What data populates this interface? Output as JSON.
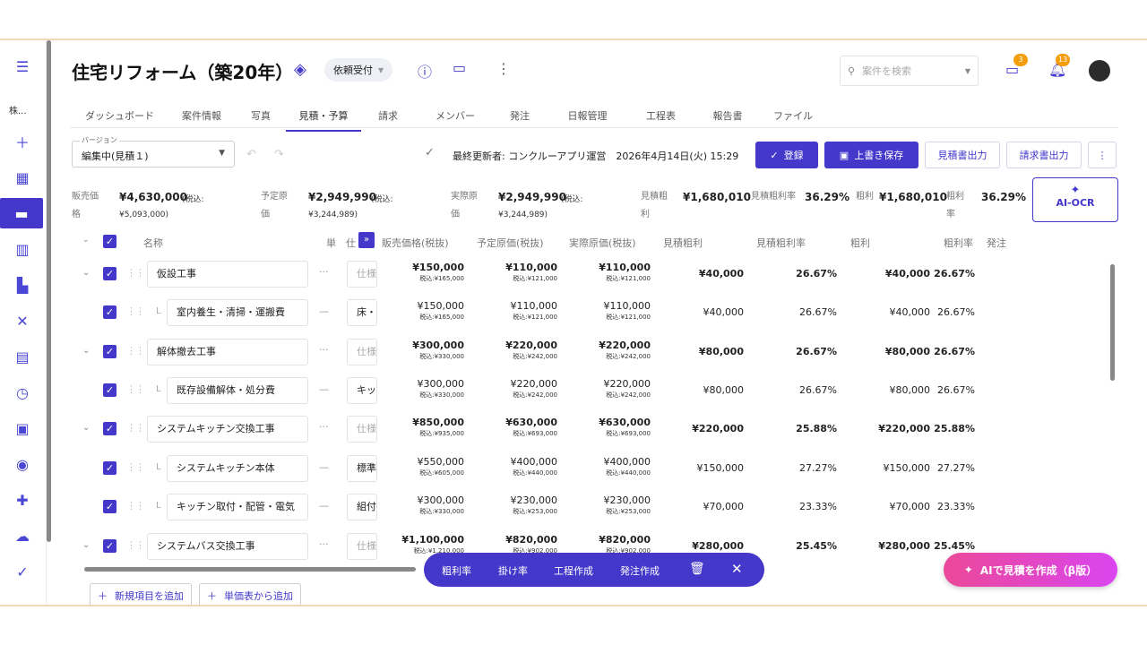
{
  "app": {
    "title": "住宅リフォーム（築20年）",
    "status": "依頼受付",
    "search_placeholder": "案件を検索",
    "chat_badge": "3",
    "bell_badge": "13",
    "company": "株..."
  },
  "tabs": [
    "ダッシュボード",
    "案件情報",
    "写真",
    "見積・予算",
    "請求",
    "メンバー",
    "発注",
    "日報管理",
    "工程表",
    "報告書",
    "ファイル"
  ],
  "toolbar": {
    "version_label": "バージョン",
    "version_value": "編集中(見積１)",
    "last_updated": "最終更新者: コンクルーアプリ運営　2026年4月14日(火) 15:29",
    "register": "登録",
    "overwrite_save": "上書き保存",
    "export_estimate": "見積書出力",
    "export_invoice": "請求書出力"
  },
  "summary": {
    "sales_label": "販売価格",
    "sales_value": "¥4,630,000",
    "sales_tax": "(税込:",
    "sales_tax_value": "¥5,093,000)",
    "planned_label": "予定原価",
    "planned_value": "¥2,949,990",
    "planned_tax": "(税込:",
    "planned_tax_value": "¥3,244,989)",
    "actual_label": "実際原価",
    "actual_value": "¥2,949,990",
    "actual_tax": "(税込:",
    "actual_tax_value": "¥3,244,989)",
    "est_profit_label": "見積粗利",
    "est_profit_value": "¥1,680,010",
    "est_rate_label": "見積粗利率",
    "est_rate_value": "36.29%",
    "profit_label": "粗利",
    "profit_value": "¥1,680,010",
    "rate_label": "粗利率",
    "rate_value": "36.29%",
    "ai_ocr": "AI-OCR"
  },
  "table": {
    "headers": {
      "name": "名称",
      "short1": "単",
      "short2": "仕",
      "sales": "販売価格(税抜)",
      "planned": "予定原価(税抜)",
      "actual": "実際原価(税抜)",
      "est_profit": "見積粗利",
      "est_rate": "見積粗利率",
      "profit": "粗利",
      "rate": "粗利率",
      "order": "発注"
    },
    "rows": [
      {
        "name": "仮設工事",
        "spec": "仕様",
        "sales": "¥150,000",
        "sales_tax": "税込:¥165,000",
        "planned": "¥110,000",
        "planned_tax": "税込:¥121,000",
        "actual": "¥110,000",
        "actual_tax": "税込:¥121,000",
        "est_profit": "¥40,000",
        "est_rate": "26.67%",
        "profit": "¥40,000",
        "rate": "26.67%"
      },
      {
        "name": "室内養生・清掃・運搬費",
        "spec": "床・",
        "sales": "¥150,000",
        "sales_tax": "税込:¥165,000",
        "planned": "¥110,000",
        "planned_tax": "税込:¥121,000",
        "actual": "¥110,000",
        "actual_tax": "税込:¥121,000",
        "est_profit": "¥40,000",
        "est_rate": "26.67%",
        "profit": "¥40,000",
        "rate": "26.67%"
      },
      {
        "name": "解体撤去工事",
        "spec": "仕様",
        "sales": "¥300,000",
        "sales_tax": "税込:¥330,000",
        "planned": "¥220,000",
        "planned_tax": "税込:¥242,000",
        "actual": "¥220,000",
        "actual_tax": "税込:¥242,000",
        "est_profit": "¥80,000",
        "est_rate": "26.67%",
        "profit": "¥80,000",
        "rate": "26.67%"
      },
      {
        "name": "既存設備解体・処分費",
        "spec": "キッ",
        "sales": "¥300,000",
        "sales_tax": "税込:¥330,000",
        "planned": "¥220,000",
        "planned_tax": "税込:¥242,000",
        "actual": "¥220,000",
        "actual_tax": "税込:¥242,000",
        "est_profit": "¥80,000",
        "est_rate": "26.67%",
        "profit": "¥80,000",
        "rate": "26.67%"
      },
      {
        "name": "システムキッチン交換工事",
        "spec": "仕様",
        "sales": "¥850,000",
        "sales_tax": "税込:¥935,000",
        "planned": "¥630,000",
        "planned_tax": "税込:¥693,000",
        "actual": "¥630,000",
        "actual_tax": "税込:¥693,000",
        "est_profit": "¥220,000",
        "est_rate": "25.88%",
        "profit": "¥220,000",
        "rate": "25.88%"
      },
      {
        "name": "システムキッチン本体",
        "spec": "標準",
        "sales": "¥550,000",
        "sales_tax": "税込:¥605,000",
        "planned": "¥400,000",
        "planned_tax": "税込:¥440,000",
        "actual": "¥400,000",
        "actual_tax": "税込:¥440,000",
        "est_profit": "¥150,000",
        "est_rate": "27.27%",
        "profit": "¥150,000",
        "rate": "27.27%"
      },
      {
        "name": "キッチン取付・配管・電気",
        "spec": "組付",
        "sales": "¥300,000",
        "sales_tax": "税込:¥330,000",
        "planned": "¥230,000",
        "planned_tax": "税込:¥253,000",
        "actual": "¥230,000",
        "actual_tax": "税込:¥253,000",
        "est_profit": "¥70,000",
        "est_rate": "23.33%",
        "profit": "¥70,000",
        "rate": "23.33%"
      },
      {
        "name": "システムバス交換工事",
        "spec": "仕様",
        "sales": "¥1,100,000",
        "sales_tax": "税込:¥1,210,000",
        "planned": "¥820,000",
        "planned_tax": "税込:¥902,000",
        "actual": "¥820,000",
        "actual_tax": "税込:¥902,000",
        "est_profit": "¥280,000",
        "est_rate": "25.45%",
        "profit": "¥280,000",
        "rate": "25.45%"
      }
    ]
  },
  "bottom": {
    "add_item": "新規項目を追加",
    "add_from_price": "単価表から追加",
    "ai_make": "AIで見積を作成（β版）"
  },
  "actionbar": {
    "gross_rate": "粗利率",
    "markup": "掛け率",
    "make_schedule": "工程作成",
    "make_order": "発注作成"
  },
  "colors": {
    "accent": "#4338ca",
    "ai_gradient_start": "#ec4899",
    "ai_gradient_end": "#d946ef"
  }
}
